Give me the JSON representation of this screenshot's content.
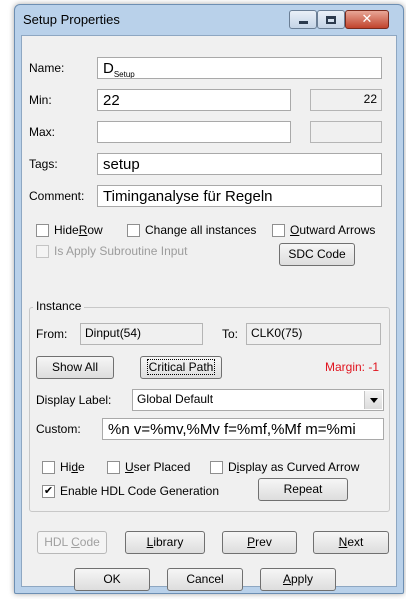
{
  "window": {
    "title": "Setup Properties"
  },
  "fields": {
    "name_label": "Name:",
    "name_main": "D",
    "name_sub": "Setup",
    "min_label": "Min:",
    "min_value": "22",
    "min_readout": "22",
    "max_label": "Max:",
    "max_value": "",
    "max_readout": "",
    "tags_label": "Tags:",
    "tags_value": "setup",
    "comment_label": "Comment:",
    "comment_value": "Timinganalyse für Regeln"
  },
  "options": {
    "hide_row_pre": "Hide ",
    "hide_row_key": "R",
    "hide_row_post": "ow",
    "hide_row_checked": false,
    "change_all_label": "Change all instances",
    "change_all_checked": false,
    "outward_key": "O",
    "outward_post": "utward Arrows",
    "outward_checked": false,
    "apply_sub_label": "Is Apply Subroutine Input",
    "apply_sub_checked": false,
    "sdc_button": "SDC Code"
  },
  "instance": {
    "group_label": "Instance",
    "from_label": "From:",
    "from_value": "Dinput(54)",
    "to_label": "To:",
    "to_value": "CLK0(75)",
    "show_all_button": "Show All",
    "critical_path_button": "Critical Path",
    "margin_text": "Margin: -1",
    "display_label_label": "Display Label:",
    "display_label_value": "Global Default",
    "custom_label": "Custom:",
    "custom_value": "%n v=%mv,%Mv f=%mf,%Mf m=%mi",
    "hide_pre": "Hi",
    "hide_key": "d",
    "hide_post": "e",
    "hide_checked": false,
    "user_key": "U",
    "user_post": "ser Placed",
    "user_checked": false,
    "curved_pre": "D",
    "curved_key": "i",
    "curved_post": "splay as Curved Arrow",
    "curved_checked": false,
    "hdl_gen_label": "Enable HDL Code Generation",
    "hdl_gen_checked": true,
    "repeat_button": "Repeat"
  },
  "buttons": {
    "hdl_pre": "HDL ",
    "hdl_key": "C",
    "hdl_post": "ode",
    "library_key": "L",
    "library_post": "ibrary",
    "prev_key": "P",
    "prev_post": "rev",
    "next_key": "N",
    "next_post": "ext",
    "ok": "OK",
    "cancel": "Cancel",
    "apply_key": "A",
    "apply_post": "pply"
  },
  "colors": {
    "margin_text": "#e0131e",
    "titlebar": "#b9d1ea",
    "close_button": "#c1432c"
  }
}
